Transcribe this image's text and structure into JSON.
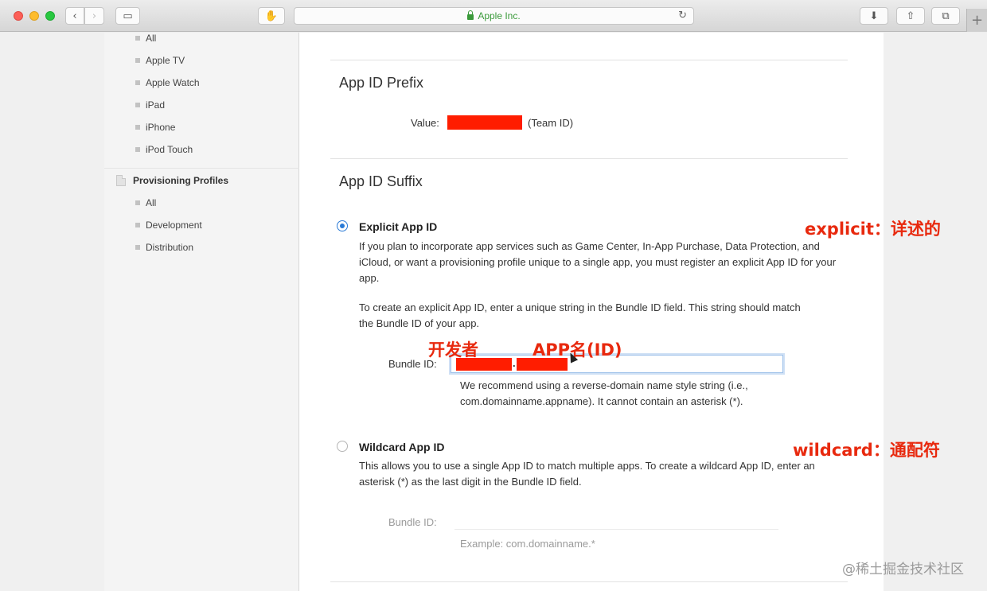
{
  "browser": {
    "url_display": "Apple Inc.",
    "back_glyph": "‹",
    "forward_glyph": "›",
    "sidebar_glyph": "▭",
    "extension_glyph": "✋",
    "reload_glyph": "↻",
    "download_glyph": "⬇",
    "share_glyph": "⇧",
    "tabs_glyph": "⧉",
    "newtab_glyph": "+"
  },
  "sidebar": {
    "items_top": [
      "All",
      "Apple TV",
      "Apple Watch",
      "iPad",
      "iPhone",
      "iPod Touch"
    ],
    "group_label": "Provisioning Profiles",
    "group_items": [
      "All",
      "Development",
      "Distribution"
    ]
  },
  "prefix": {
    "heading": "App ID Prefix",
    "value_label": "Value:",
    "team_id_note": "(Team ID)"
  },
  "suffix": {
    "heading": "App ID Suffix",
    "explicit": {
      "label": "Explicit App ID",
      "selected": true,
      "desc1": "If you plan to incorporate app services such as Game Center, In-App Purchase, Data Protection, and iCloud, or want a provisioning profile unique to a single app, you must register an explicit App ID for your app.",
      "desc2": "To create an explicit App ID, enter a unique string in the Bundle ID field. This string should match the Bundle ID of your app.",
      "bundle_label": "Bundle ID:",
      "bundle_separator": ".",
      "hint": "We recommend using a reverse-domain name style string (i.e., com.domainname.appname). It cannot contain an asterisk (*)."
    },
    "wildcard": {
      "label": "Wildcard App ID",
      "selected": false,
      "desc": "This allows you to use a single App ID to match multiple apps. To create a wildcard App ID, enter an asterisk (*) as the last digit in the Bundle ID field.",
      "bundle_label": "Bundle ID:",
      "example": "Example: com.domainname.*"
    }
  },
  "annotations": {
    "explicit_note": "explicit：详述的",
    "developer": "开发者",
    "app_name": "APP名(ID)",
    "wildcard_note": "wildcard：通配符"
  },
  "watermark": "@稀土掘金技术社区",
  "colors": {
    "annotation_red": "#e8290e",
    "redaction_red": "#ff1d00",
    "radio_blue": "#2a7ad6",
    "secure_green": "#3a9a3a"
  }
}
